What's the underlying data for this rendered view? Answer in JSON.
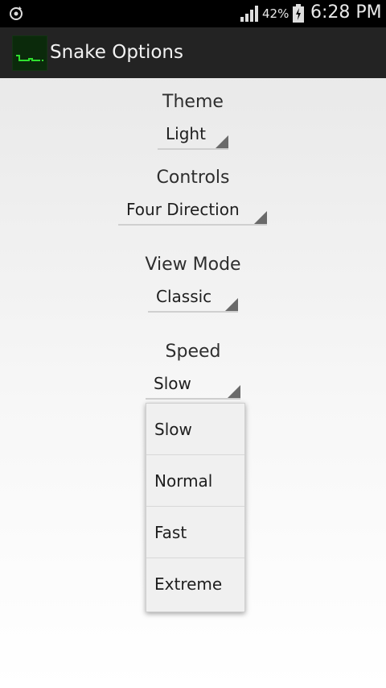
{
  "status_bar": {
    "battery_percent": "42%",
    "time": "6:28 PM"
  },
  "action_bar": {
    "title": "Snake Options"
  },
  "options": {
    "theme": {
      "label": "Theme",
      "value": "Light"
    },
    "controls": {
      "label": "Controls",
      "value": "Four Direction"
    },
    "view_mode": {
      "label": "View Mode",
      "value": "Classic"
    },
    "speed": {
      "label": "Speed",
      "value": "Slow"
    }
  },
  "speed_dropdown": {
    "items": [
      "Slow",
      "Normal",
      "Fast",
      "Extreme"
    ]
  }
}
